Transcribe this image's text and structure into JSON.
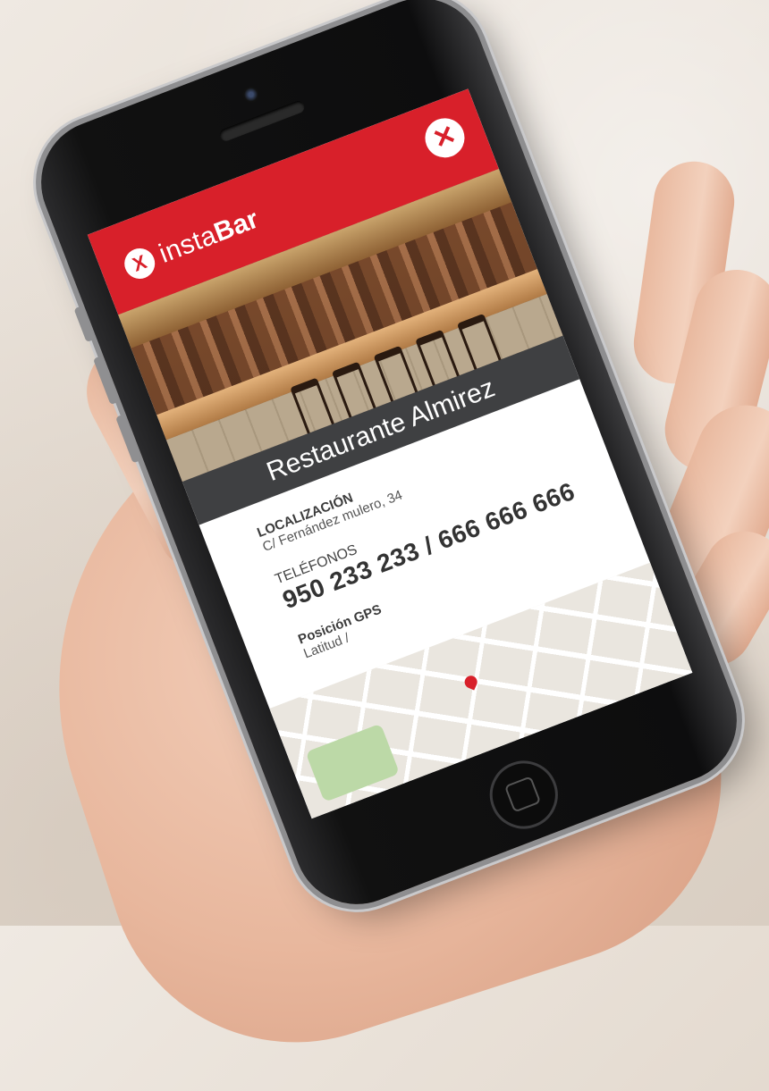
{
  "app": {
    "logo_icon": "X",
    "logo_insta": "insta",
    "logo_bar": "Bar",
    "close_symbol": "✕"
  },
  "restaurant": {
    "name": "Restaurante Almirez",
    "location_label": "LOCALIZACIÓN",
    "location_value": "C/ Fernández mulero, 34",
    "phones_label": "TELÉFONOS",
    "phones_value": "950 233 233 / 666 666 666",
    "gps_label": "Posición GPS",
    "gps_value": "Latitud /"
  },
  "colors": {
    "brand_red": "#d8202a",
    "title_bar": "#3f4042"
  }
}
